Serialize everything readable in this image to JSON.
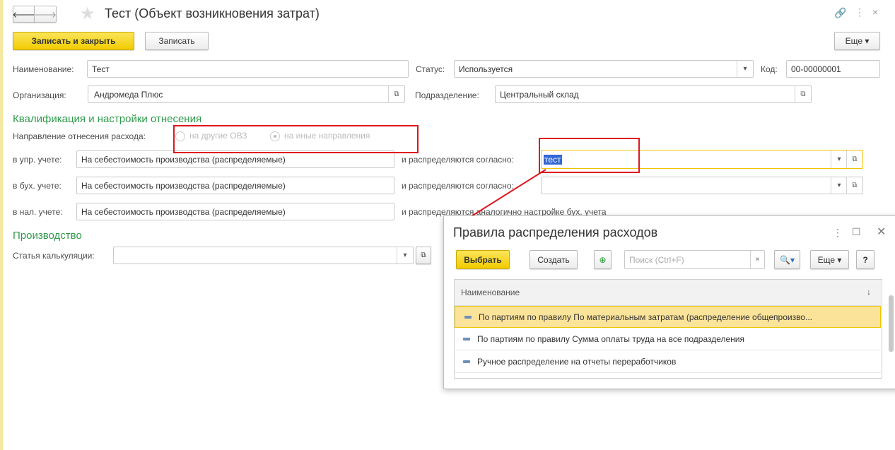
{
  "window": {
    "title": "Тест (Объект возникновения затрат)"
  },
  "toolbar": {
    "save_close": "Записать и закрыть",
    "save": "Записать",
    "more": "Еще"
  },
  "fields": {
    "name_label": "Наименование:",
    "name_value": "Тест",
    "status_label": "Статус:",
    "status_value": "Используется",
    "code_label": "Код:",
    "code_value": "00-00000001",
    "org_label": "Организация:",
    "org_value": "Андромеда Плюс",
    "dept_label": "Подразделение:",
    "dept_value": "Центральный склад"
  },
  "qualification": {
    "heading": "Квалификация и настройки отнесения",
    "direction_label": "Направление отнесения расхода:",
    "options": [
      "на другие ОВЗ",
      "на иные направления"
    ],
    "selected": 1,
    "mgmt_label": "в упр. учете:",
    "mgmt_value": "На себестоимость производства (распределяемые)",
    "mgmt_dist_label": "и распределяются согласно:",
    "mgmt_dist_value": "тест",
    "acc_label": "в бух. учете:",
    "acc_value": "На себестоимость производства (распределяемые)",
    "acc_dist_label": "и распределяются согласно:",
    "acc_dist_value": "",
    "tax_label": "в нал. учете:",
    "tax_value": "На себестоимость производства (распределяемые)",
    "tax_dist_text": "и распределяются аналогично настройке бух. учета"
  },
  "production": {
    "heading": "Производство",
    "calc_label": "Статья калькуляции:",
    "calc_value": ""
  },
  "popup": {
    "title": "Правила распределения расходов",
    "select": "Выбрать",
    "create": "Создать",
    "search_placeholder": "Поиск (Ctrl+F)",
    "more": "Еще",
    "help": "?",
    "column": "Наименование",
    "sort": "↓",
    "rows": [
      "По партиям по правилу По материальным затратам (распределение общепроизво...",
      "По партиям по правилу Сумма оплаты труда на все подразделения",
      "Ручное распределение на отчеты переработчиков"
    ],
    "selected_row": 0
  },
  "colors": {
    "accent": "#f1cb00",
    "heading": "#2e9a4a",
    "annotation": "#e0161d"
  }
}
